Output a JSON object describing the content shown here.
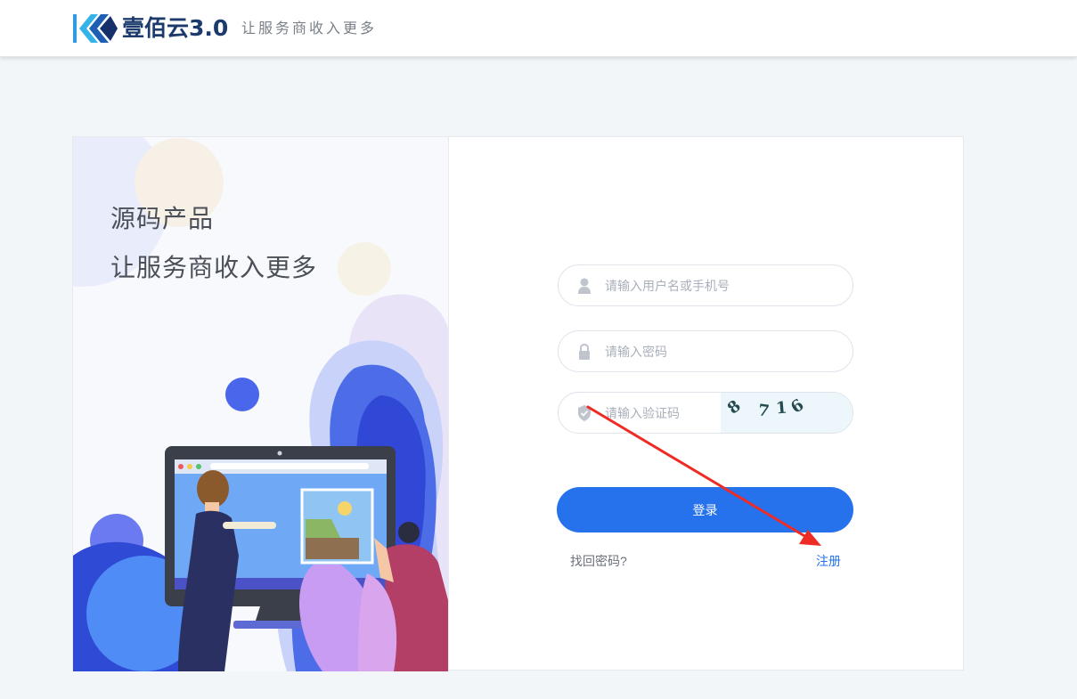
{
  "header": {
    "brand_name": "壹佰云3.0",
    "slogan": "让服务商收入更多"
  },
  "promo": {
    "line1": "源码产品",
    "line2": "让服务商收入更多"
  },
  "form": {
    "username_placeholder": "请输入用户名或手机号",
    "password_placeholder": "请输入密码",
    "captcha_placeholder": "请输入验证码",
    "captcha_chars": [
      "8",
      "7",
      "1",
      "6"
    ],
    "login_label": "登录",
    "forgot_label": "找回密码?",
    "register_label": "注册"
  },
  "colors": {
    "primary": "#2672ec",
    "annotation_arrow": "#ee2b24"
  }
}
